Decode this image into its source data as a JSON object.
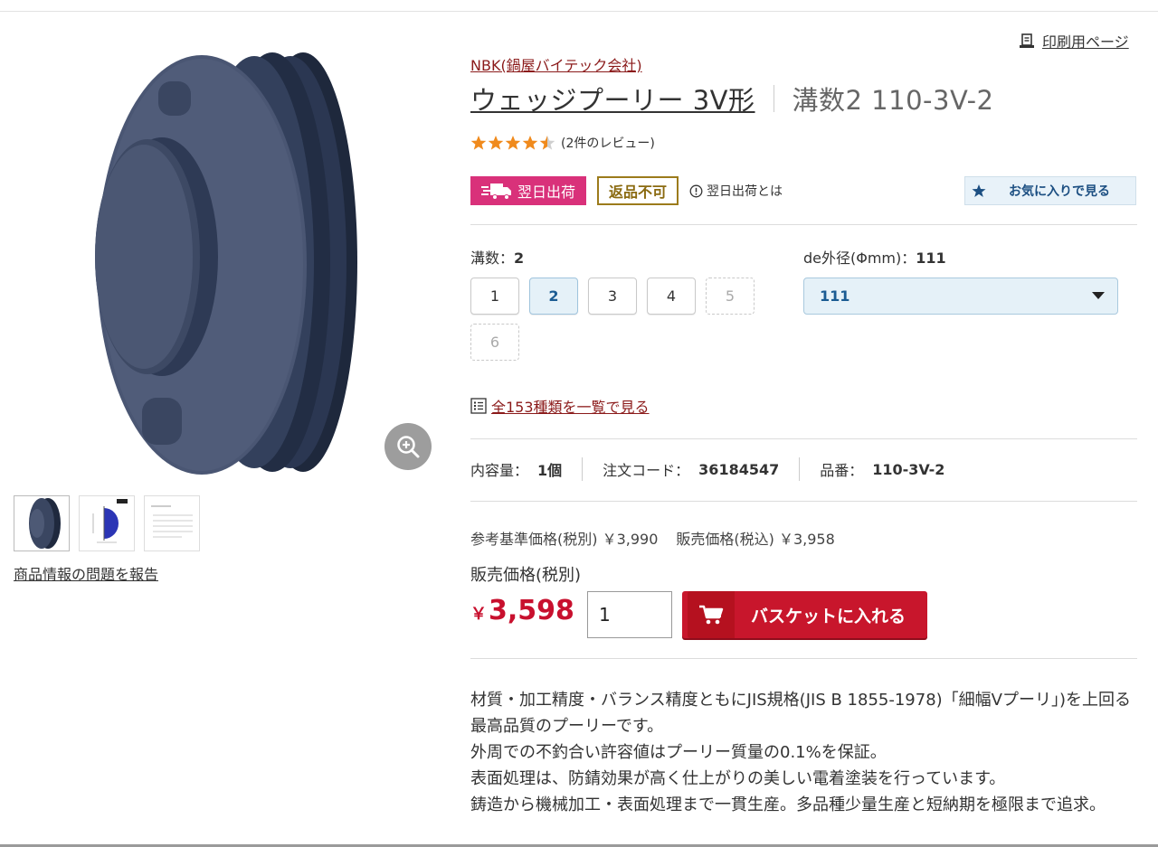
{
  "print_link": "印刷用ページ",
  "brand": "NBK(鍋屋バイテック会社)",
  "title": {
    "main": "ウェッジプーリー 3V形",
    "sub": "溝数2 110-3V-2"
  },
  "rating": {
    "value": 4.5,
    "max": 5,
    "review_text": "(2件のレビュー)"
  },
  "badges": {
    "next_day": "翌日出荷",
    "no_return": "返品不可",
    "info": "翌日出荷とは"
  },
  "favorite": "お気に入りで見る",
  "groove_option": {
    "label": "溝数：",
    "selected": "2",
    "buttons": [
      {
        "label": "1",
        "state": "normal"
      },
      {
        "label": "2",
        "state": "selected"
      },
      {
        "label": "3",
        "state": "normal"
      },
      {
        "label": "4",
        "state": "normal"
      },
      {
        "label": "5",
        "state": "disabled"
      },
      {
        "label": "6",
        "state": "disabled"
      }
    ]
  },
  "diameter_option": {
    "label": "de外径(Φmm)：",
    "selected": "111"
  },
  "list_link": "全153種類を一覧で見る",
  "specs": {
    "content_label": "内容量：",
    "content_value": "1個",
    "order_code_label": "注文コード：",
    "order_code_value": "36184547",
    "part_no_label": "品番：",
    "part_no_value": "110-3V-2"
  },
  "ref_price": {
    "base": "参考基準価格(税別) ￥3,990",
    "sale_incl": "販売価格(税込) ￥3,958"
  },
  "price": {
    "label": "販売価格(税別)",
    "currency": "￥",
    "value": "3,598"
  },
  "quantity": "1",
  "cart_button": "バスケットに入れる",
  "report_link": "商品情報の問題を報告",
  "description": [
    "材質・加工精度・バランス精度ともにJIS規格(JIS B 1855-1978)「細幅Vプーリ」)を上回る最高品質のプーリーです。",
    "外周での不釣合い許容値はプーリー質量の0.1%を保証。",
    "表面処理は、防錆効果が高く仕上がりの美しい電着塗装を行っています。",
    "鋳造から機械加工・表面処理まで一貫生産。多品種少量生産と短納期を極限まで追求。"
  ],
  "colors": {
    "accent_red": "#c8102e",
    "brand_link": "#8b1a1a",
    "next_day_pink": "#d9317a",
    "select_blue": "#1b5c93"
  }
}
